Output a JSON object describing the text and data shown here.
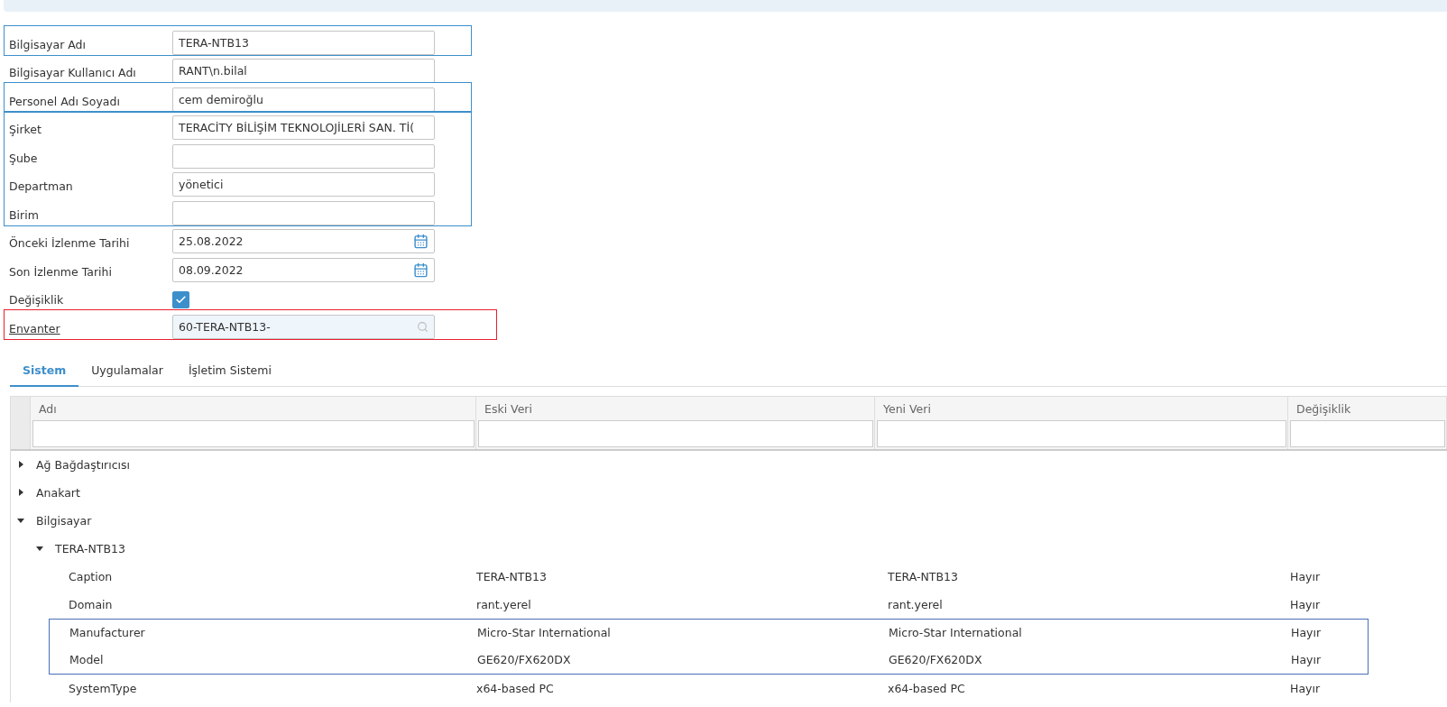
{
  "form": {
    "groups": [
      {
        "color": "#3d8fcb",
        "fields": [
          {
            "kind": "text",
            "label": "Bilgisayar Adı",
            "value": "TERA-NTB13"
          }
        ]
      },
      {
        "fields": [
          {
            "kind": "text",
            "label": "Bilgisayar Kullanıcı Adı",
            "value": "RANT\\n.bilal"
          }
        ]
      },
      {
        "color": "#3d8fcb",
        "fields": [
          {
            "kind": "text",
            "label": "Personel Adı Soyadı",
            "value": "cem demiroğlu"
          }
        ]
      },
      {
        "color": "#3d8fcb",
        "fields": [
          {
            "kind": "text",
            "label": "Şirket",
            "value": "TERACİTY BİLİŞİM TEKNOLOJİLERİ SAN. Tİ("
          },
          {
            "kind": "text",
            "label": "Şube"
          },
          {
            "kind": "text",
            "label": "Departman",
            "value": "yönetici"
          },
          {
            "kind": "text",
            "label": "Birim"
          }
        ]
      },
      {
        "fields": [
          {
            "kind": "date",
            "label": "Önceki İzlenme Tarihi",
            "value": "25.08.2022"
          },
          {
            "kind": "date",
            "label": "Son İzlenme Tarihi",
            "value": "08.09.2022"
          },
          {
            "kind": "checkbox",
            "label": "Değişiklik",
            "checked": true
          }
        ]
      },
      {
        "color": "#e8202f",
        "fields": [
          {
            "kind": "lookup",
            "label": "Envanter",
            "value": "60-TERA-NTB13-"
          }
        ]
      }
    ]
  },
  "tabs": [
    {
      "label": "Sistem",
      "selected": true
    },
    {
      "label": "Uygulamalar",
      "selected": false
    },
    {
      "label": "İşletim Sistemi",
      "selected": false
    }
  ],
  "table": {
    "columns": [
      "Adı",
      "Eski Veri",
      "Yeni Veri",
      "Değişiklik"
    ],
    "rows": [
      {
        "kind": "group",
        "label": "Ağ Bağdaştırıcısı",
        "expanded": false
      },
      {
        "kind": "group",
        "label": "Anakart",
        "expanded": false
      },
      {
        "kind": "group",
        "label": "Bilgisayar",
        "expanded": true,
        "children": [
          {
            "kind": "group",
            "label": "TERA-NTB13",
            "expanded": true,
            "children": [
              {
                "kind": "leaf",
                "label": "Caption",
                "old": "TERA-NTB13",
                "new": "TERA-NTB13",
                "changed": "Hayır",
                "framed": false
              },
              {
                "kind": "leaf",
                "label": "Domain",
                "old": "rant.yerel",
                "new": "rant.yerel",
                "changed": "Hayır",
                "framed": false
              },
              {
                "kind": "leaf",
                "label": "Manufacturer",
                "old": "Micro-Star International",
                "new": "Micro-Star International",
                "changed": "Hayır",
                "framed": true
              },
              {
                "kind": "leaf",
                "label": "Model",
                "old": "GE620/FX620DX",
                "new": "GE620/FX620DX",
                "changed": "Hayır",
                "framed": true
              },
              {
                "kind": "leaf",
                "label": "SystemType",
                "old": "x64-based PC",
                "new": "x64-based PC",
                "changed": "Hayır",
                "framed": false
              }
            ]
          }
        ]
      }
    ]
  }
}
